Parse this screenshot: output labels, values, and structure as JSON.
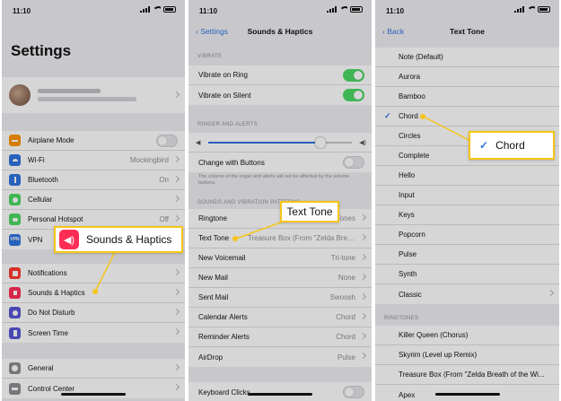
{
  "status": {
    "time": "11:10"
  },
  "panel1": {
    "title": "Settings",
    "rows": [
      {
        "label": "Airplane Mode",
        "type": "toggle",
        "color": "#ff9500"
      },
      {
        "label": "Wi-Fi",
        "value": "Mockingbird",
        "color": "#2f74e0"
      },
      {
        "label": "Bluetooth",
        "value": "On",
        "color": "#2f74e0"
      },
      {
        "label": "Cellular",
        "color": "#4cd964"
      },
      {
        "label": "Personal Hotspot",
        "value": "Off",
        "color": "#4cd964"
      },
      {
        "label": "VPN",
        "color": "#2f74e0"
      }
    ],
    "rows2": [
      {
        "label": "Notifications",
        "color": "#ff3b30"
      },
      {
        "label": "Sounds & Haptics",
        "color": "#ff2d55"
      },
      {
        "label": "Do Not Disturb",
        "color": "#5856d6"
      },
      {
        "label": "Screen Time",
        "color": "#5856d6"
      }
    ],
    "rows3": [
      {
        "label": "General",
        "color": "#8e8e93"
      },
      {
        "label": "Control Center",
        "color": "#8e8e93"
      }
    ],
    "callout": "Sounds & Haptics"
  },
  "panel2": {
    "back": "Settings",
    "title": "Sounds & Haptics",
    "vibrate_header": "VIBRATE",
    "vibrate_ring": "Vibrate on Ring",
    "vibrate_silent": "Vibrate on Silent",
    "ringer_header": "RINGER AND ALERTS",
    "change_buttons": "Change with Buttons",
    "ringer_note": "The volume of the ringer and alerts will not be affected by the volume buttons.",
    "patterns_header": "SOUNDS AND VIBRATION PATTERNS",
    "rows": [
      {
        "label": "Ringtone",
        "value": "Tones"
      },
      {
        "label": "Text Tone",
        "value": "Treasure Box (From \"Zelda Breath..."
      },
      {
        "label": "New Voicemail",
        "value": "Tri-tone"
      },
      {
        "label": "New Mail",
        "value": "None"
      },
      {
        "label": "Sent Mail",
        "value": "Swoosh"
      },
      {
        "label": "Calendar Alerts",
        "value": "Chord"
      },
      {
        "label": "Reminder Alerts",
        "value": "Chord"
      },
      {
        "label": "AirDrop",
        "value": "Pulse"
      }
    ],
    "keyboard_clicks": "Keyboard Clicks",
    "callout": "Text Tone"
  },
  "panel3": {
    "back": "Back",
    "title": "Text Tone",
    "tones": [
      "Note (Default)",
      "Aurora",
      "Bamboo",
      "Chord",
      "Circles",
      "Complete",
      "Hello",
      "Input",
      "Keys",
      "Popcorn",
      "Pulse",
      "Synth",
      "Classic"
    ],
    "selected": "Chord",
    "ringtones_header": "RINGTONES",
    "ringtones": [
      "Killer Queen (Chorus)",
      "Skyrim (Level up Remix)",
      "Treasure Box (From \"Zelda Breath of the Wi...",
      "Apex"
    ],
    "callout": "Chord"
  }
}
